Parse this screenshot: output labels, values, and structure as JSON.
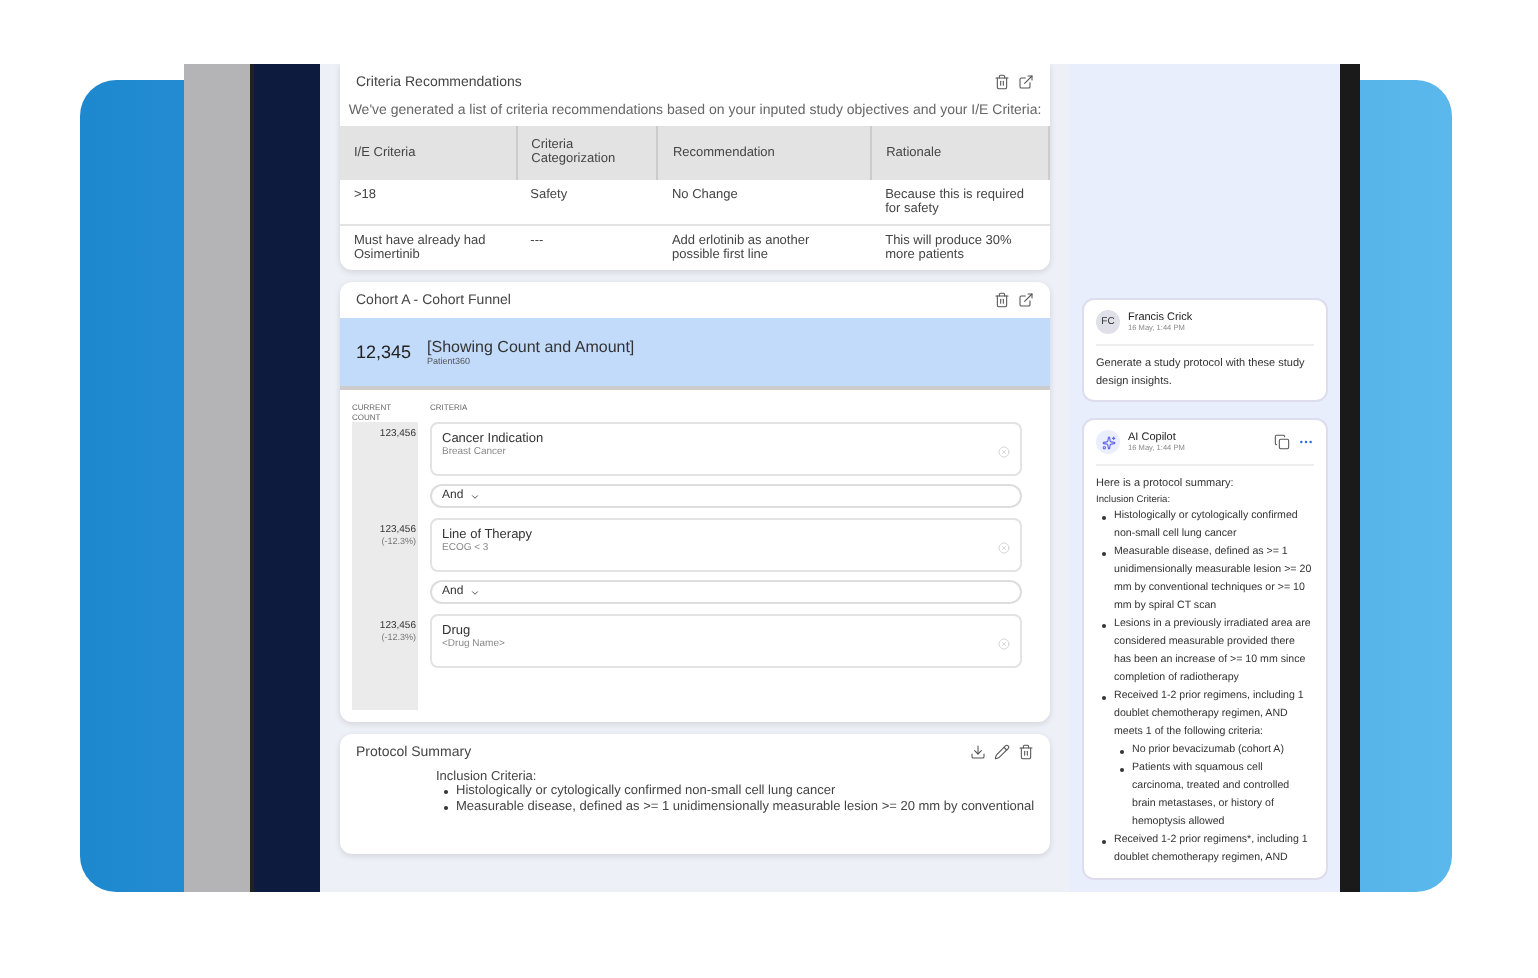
{
  "criteria_card": {
    "title": "Criteria Recommendations",
    "intro": "We've generated a list of criteria recommendations based on your inputed study objectives and your I/E Criteria:",
    "columns": [
      "I/E Criteria",
      "Criteria Categorization",
      "Recommendation",
      "Rationale"
    ],
    "rows": [
      [
        ">18",
        "Safety",
        "No Change",
        "Because this is required for safety"
      ],
      [
        "Must have already had Osimertinib",
        "---",
        "Add erlotinib as another possible first line",
        "This will produce 30% more patients"
      ]
    ]
  },
  "funnel_card": {
    "title": "Cohort A - Cohort Funnel",
    "count": "12,345",
    "heading": "[Showing Count and Amount]",
    "subheading": "Patient360",
    "count_label": "CURRENT COUNT",
    "criteria_label": "CRITERIA",
    "connectors": [
      "And",
      "And"
    ],
    "steps": [
      {
        "count": "123,456",
        "title": "Cancer Indication",
        "value": "Breast Cancer"
      },
      {
        "count": "123,456",
        "change": "(-12.3%)",
        "title": "Line of Therapy",
        "value": "ECOG < 3"
      },
      {
        "count": "123,456",
        "change": "(-12.3%)",
        "title": "Drug",
        "value": "<Drug Name>"
      }
    ]
  },
  "summary_card": {
    "title": "Protocol Summary",
    "section": "Inclusion Criteria:",
    "bullets": [
      "Histologically or cytologically confirmed non-small cell lung cancer",
      "Measurable disease, defined as >= 1 unidimensionally measurable lesion >= 20 mm by conventional"
    ]
  },
  "chat": {
    "messages": [
      {
        "kind": "user",
        "initials": "FC",
        "author": "Francis Crick",
        "time": "16 May, 1:44 PM",
        "text": "Generate a study protocol with these study design insights."
      },
      {
        "kind": "ai",
        "author": "AI Copilot",
        "time": "16 May, 1:44 PM",
        "intro": "Here is a protocol summary:",
        "section": "Inclusion Criteria:",
        "bullets": [
          {
            "text": "Histologically or cytologically confirmed non-small cell lung cancer"
          },
          {
            "text": "Measurable disease, defined as >= 1 unidimensionally measurable lesion >= 20 mm by conventional techniques or >= 10 mm by spiral CT scan"
          },
          {
            "text": "Lesions in a previously irradiated area are considered measurable provided there has been an increase of >= 10 mm since completion of radiotherapy"
          },
          {
            "text": "Received 1-2 prior regimens, including 1 doublet chemotherapy regimen, AND meets 1 of the following criteria:",
            "children": [
              {
                "text": "No prior bevacizumab (cohort A)"
              },
              {
                "text": "Patients with squamous cell carcinoma, treated and controlled brain metastases, or history of hemoptysis allowed"
              }
            ]
          },
          {
            "text": "Received 1-2 prior regimens*, including 1 doublet chemotherapy regimen, AND"
          }
        ]
      }
    ]
  }
}
